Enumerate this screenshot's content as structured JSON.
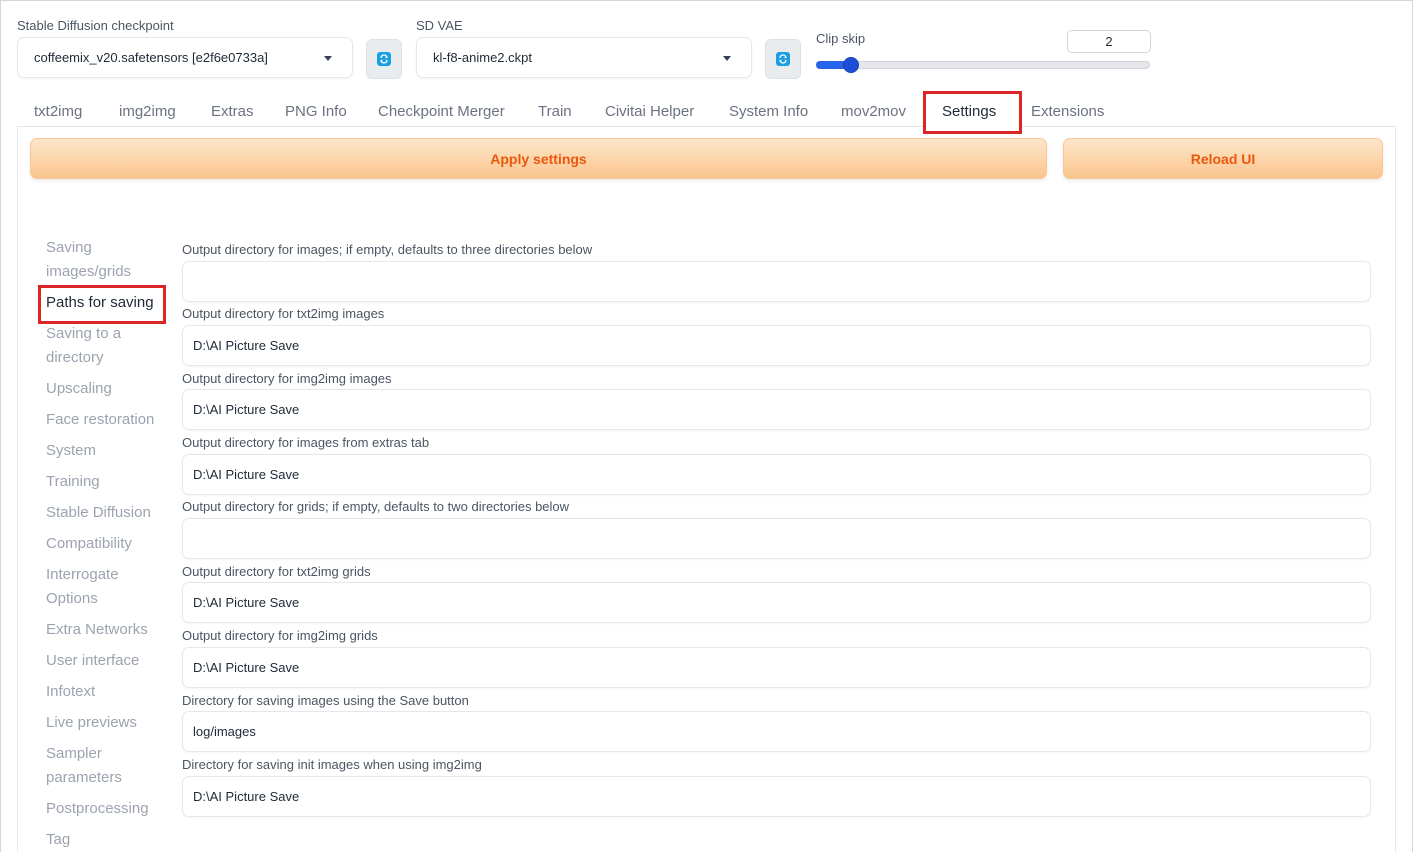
{
  "checkpoint": {
    "label": "Stable Diffusion checkpoint",
    "value": "coffeemix_v20.safetensors [e2f6e0733a]"
  },
  "vae": {
    "label": "SD VAE",
    "value": "kl-f8-anime2.ckpt"
  },
  "clip_skip": {
    "label": "Clip skip",
    "value": "2",
    "slider_fraction": 0.1
  },
  "tabs": [
    "txt2img",
    "img2img",
    "Extras",
    "PNG Info",
    "Checkpoint Merger",
    "Train",
    "Civitai Helper",
    "System Info",
    "mov2mov",
    "Settings",
    "Extensions"
  ],
  "active_tab": "Settings",
  "buttons": {
    "apply": "Apply settings",
    "reload": "Reload UI"
  },
  "sidebar": {
    "items": [
      "Saving images/grids",
      "Paths for saving",
      "Saving to a directory",
      "Upscaling",
      "Face restoration",
      "System",
      "Training",
      "Stable Diffusion",
      "Compatibility",
      "Interrogate Options",
      "Extra Networks",
      "User interface",
      "Infotext",
      "Live previews",
      "Sampler parameters",
      "Postprocessing",
      "Tag"
    ],
    "active": "Paths for saving"
  },
  "fields": [
    {
      "label": "Output directory for images; if empty, defaults to three directories below",
      "value": ""
    },
    {
      "label": "Output directory for txt2img images",
      "value": "D:\\AI Picture Save"
    },
    {
      "label": "Output directory for img2img images",
      "value": "D:\\AI Picture Save"
    },
    {
      "label": "Output directory for images from extras tab",
      "value": "D:\\AI Picture Save"
    },
    {
      "label": "Output directory for grids; if empty, defaults to two directories below",
      "value": ""
    },
    {
      "label": "Output directory for txt2img grids",
      "value": "D:\\AI Picture Save"
    },
    {
      "label": "Output directory for img2img grids",
      "value": "D:\\AI Picture Save"
    },
    {
      "label": "Directory for saving images using the Save button",
      "value": "log/images"
    },
    {
      "label": "Directory for saving init images when using img2img",
      "value": "D:\\AI Picture Save"
    }
  ],
  "colors": {
    "accent_orange": "#ea580c",
    "highlight_red": "#dc2626",
    "slider_blue": "#2563eb",
    "refresh_blue": "#1a9fe0"
  },
  "icons": {
    "refresh": "refresh-icon",
    "dropdown": "chevron-down-icon"
  }
}
